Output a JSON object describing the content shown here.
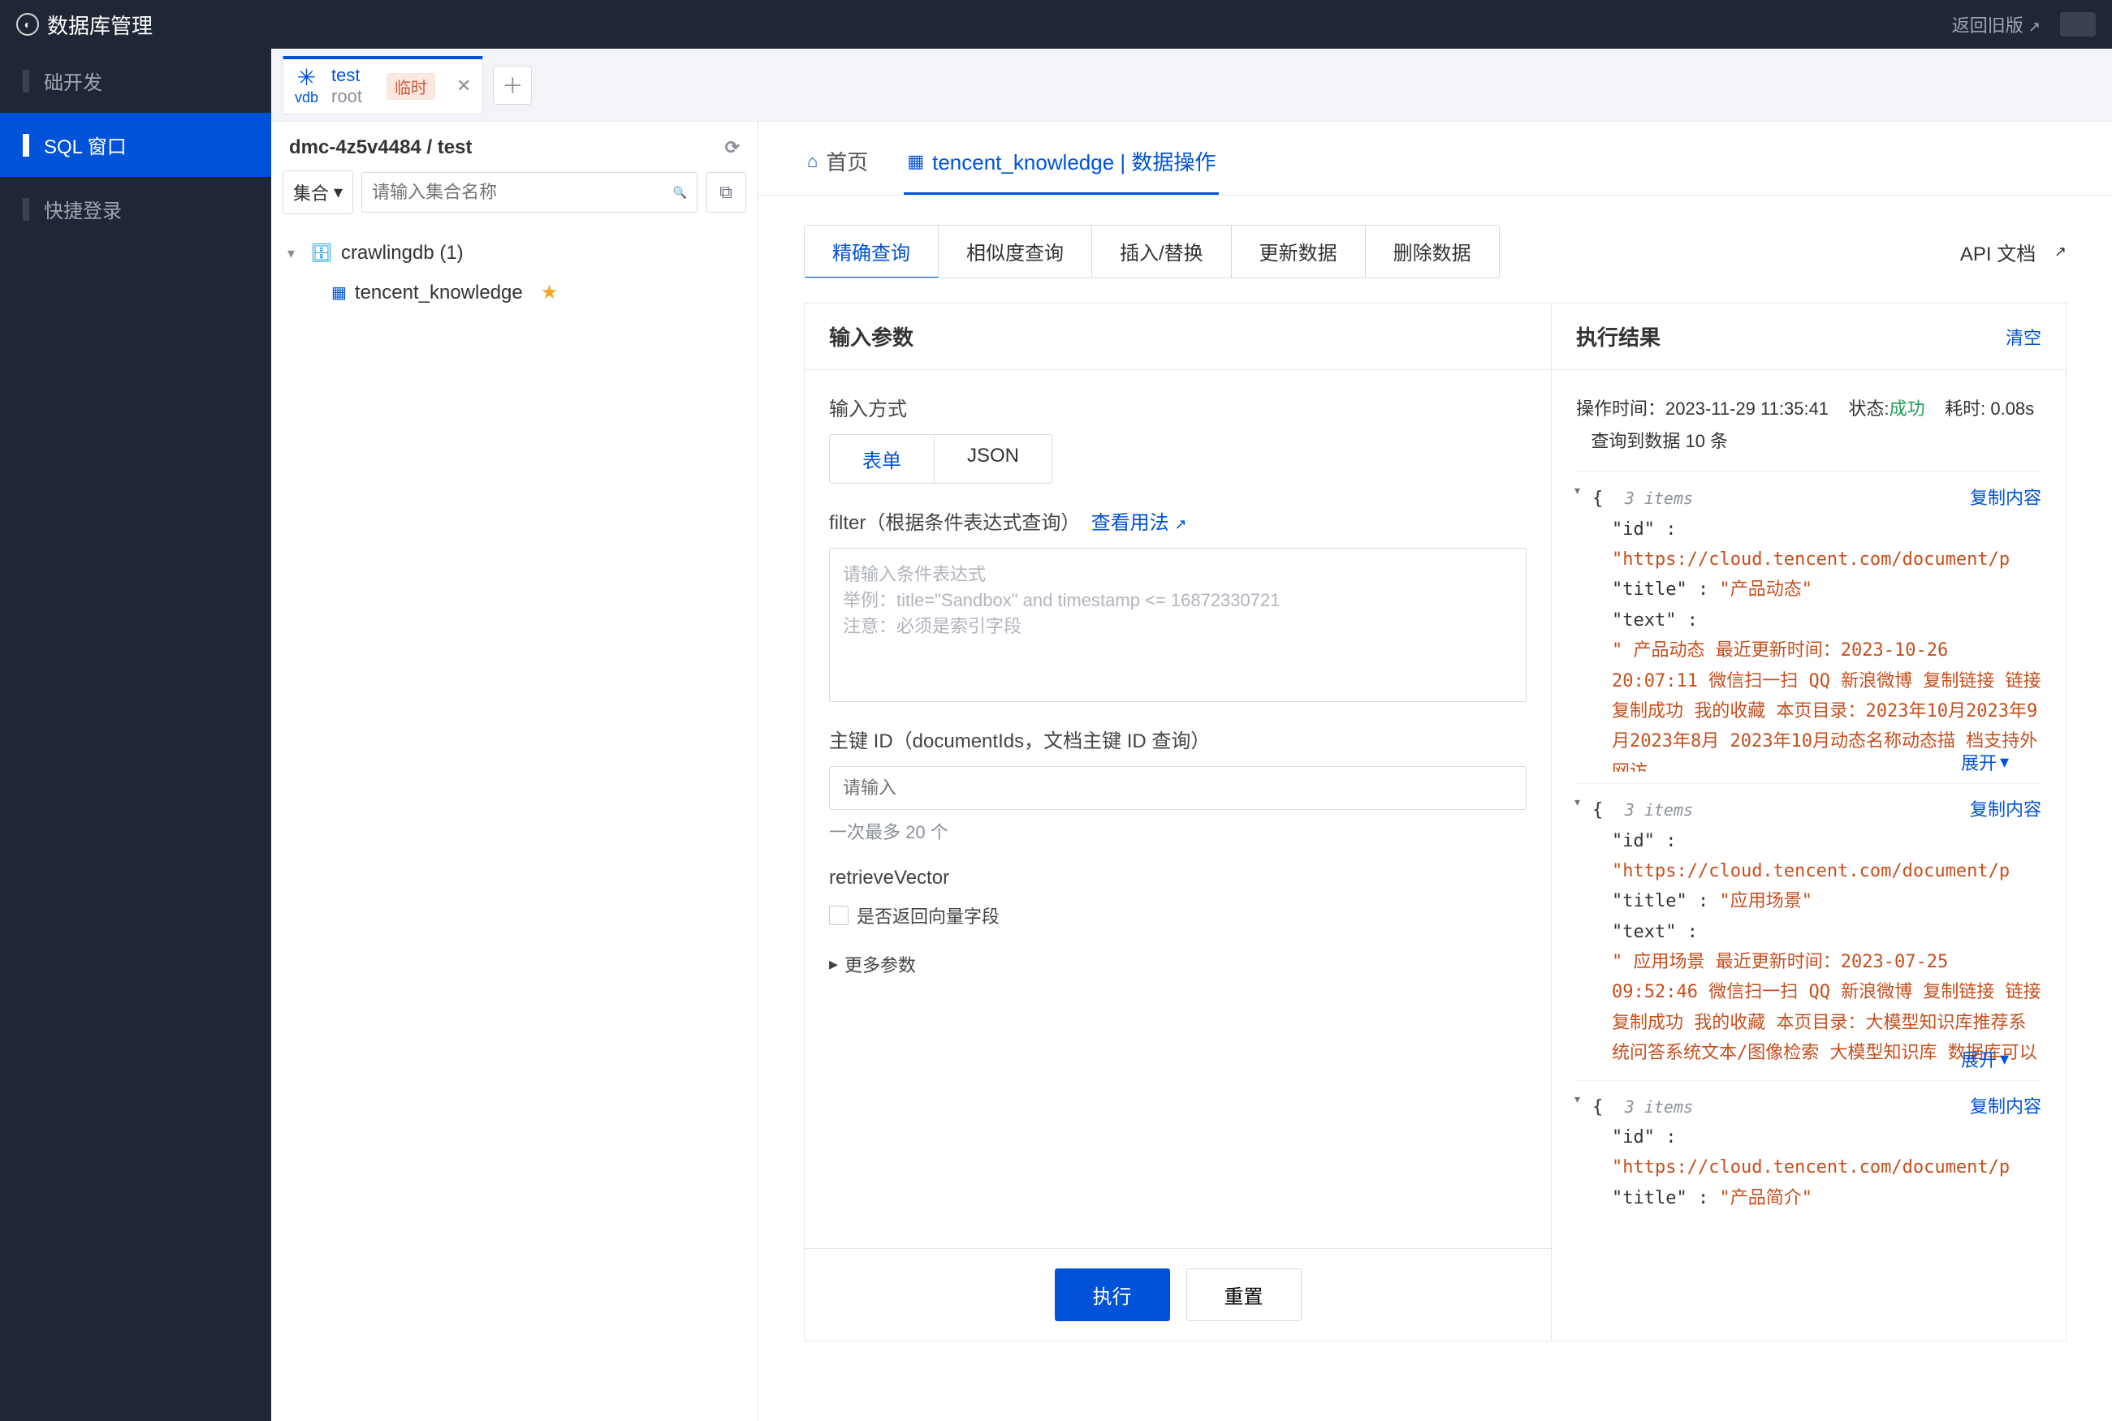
{
  "topbar": {
    "title": "数据库管理",
    "return_old": "返回旧版"
  },
  "sidebar": {
    "items": [
      {
        "label": "础开发"
      },
      {
        "label": "SQL 窗口"
      },
      {
        "label": "快捷登录"
      }
    ]
  },
  "conn_tab": {
    "vdb_label": "vdb",
    "name": "test",
    "user": "root",
    "badge": "临时"
  },
  "explorer": {
    "breadcrumb": "dmc-4z5v4484 / test",
    "filter_scope": "集合",
    "search_placeholder": "请输入集合名称",
    "db_name": "crawlingdb (1)",
    "table_name": "tencent_knowledge"
  },
  "content_tabs": {
    "home": "首页",
    "current": "tencent_knowledge | 数据操作"
  },
  "op_tabs": [
    "精确查询",
    "相似度查询",
    "插入/替换",
    "更新数据",
    "删除数据"
  ],
  "api_link": "API 文档",
  "panels": {
    "input_title": "输入参数",
    "result_title": "执行结果",
    "clear_label": "清空"
  },
  "form": {
    "input_mode_label": "输入方式",
    "input_mode_opts": [
      "表单",
      "JSON"
    ],
    "filter_label": "filter（根据条件表达式查询）",
    "filter_link": "查看用法",
    "filter_ph_line1": "请输入条件表达式",
    "filter_ph_line2": "举例：title=\"Sandbox\" and timestamp <= 16872330721",
    "filter_ph_line3": "注意：必须是索引字段",
    "pk_label": "主键 ID（documentIds，文档主键 ID 查询）",
    "pk_placeholder": "请输入",
    "pk_hint": "一次最多 20 个",
    "rv_label": "retrieveVector",
    "rv_checkbox": "是否返回向量字段",
    "more_params": "更多参数",
    "exec": "执行",
    "reset": "重置"
  },
  "result": {
    "meta_op_time_label": "操作时间：",
    "meta_op_time": "2023-11-29 11:35:41",
    "meta_status_label": "状态:",
    "meta_status": "成功",
    "meta_cost_label": "耗时:",
    "meta_cost": "0.08s",
    "meta_rows": "查询到数据 10 条",
    "items_text": "3 items",
    "copy_label": "复制内容",
    "expand_label": "展开",
    "records": [
      {
        "id": "https://cloud.tencent.com/document/p",
        "title": "产品动态",
        "text": " 产品动态 最近更新时间：2023-10-26 20:07:11 微信扫一扫 QQ 新浪微博 复制链接 链接复制成功 我的收藏 本页目录：2023年10月2023年9月2023年8月 2023年10月动态名称动态描  档支持外网访"
      },
      {
        "id": "https://cloud.tencent.com/document/p",
        "title": "应用场景",
        "text": " 应用场景 最近更新时间：2023-07-25 09:52:46 微信扫一扫 QQ 新浪微博 复制链接 链接复制成功 我的收藏 本页目录：大模型知识库推荐系统问答系统文本/图像检索 大模型知识库  数据库可以"
      },
      {
        "id": "https://cloud.tencent.com/document/p",
        "title": "产品简介",
        "text": ""
      }
    ]
  }
}
